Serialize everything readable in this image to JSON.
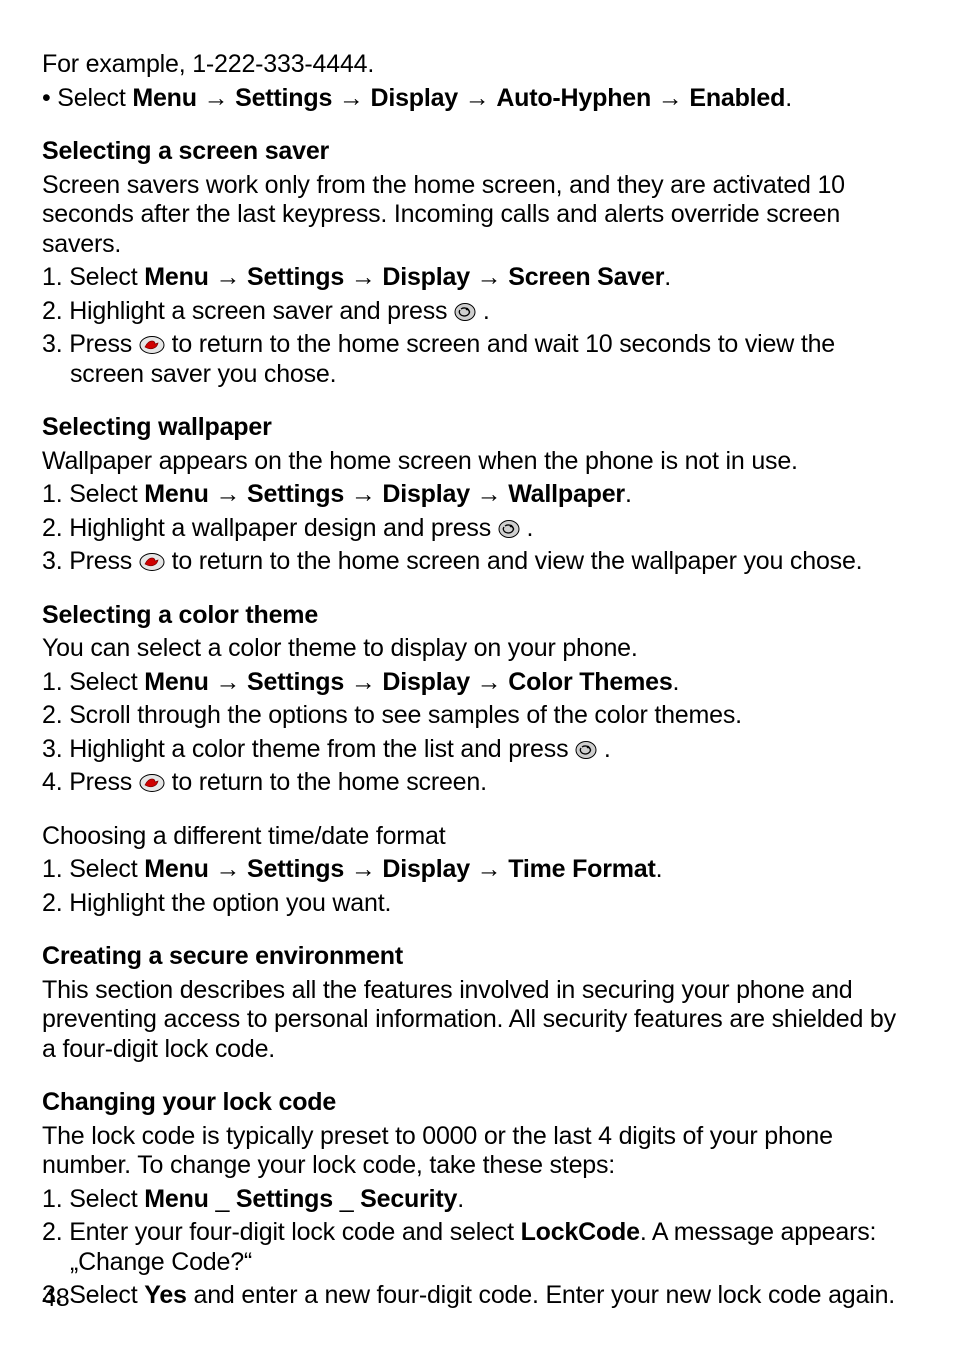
{
  "arrow": "→",
  "intro": {
    "line1": "For example, 1-222-333-4444.",
    "bullet_prefix": "• Select ",
    "path": [
      "Menu",
      "Settings",
      "Display",
      "Auto-Hyphen",
      "Enabled"
    ],
    "period": "."
  },
  "screensaver": {
    "heading": "Selecting a screen saver",
    "body": "Screen savers work only from the home screen, and they are activated 10 seconds after the last keypress. Incoming calls and alerts override screen savers.",
    "s1_prefix": "1. Select ",
    "s1_path": [
      "Menu",
      "Settings",
      "Display",
      "Screen Saver"
    ],
    "s2_a": "2. Highlight a screen saver and press ",
    "s2_b": " .",
    "s3_a": "3. Press ",
    "s3_b": " to return to the home screen and wait 10 seconds to view the screen saver you chose."
  },
  "wallpaper": {
    "heading": "Selecting wallpaper",
    "body": "Wallpaper appears on the home screen when the phone is not in use.",
    "s1_prefix": "1. Select ",
    "s1_path": [
      "Menu",
      "Settings",
      "Display",
      "Wallpaper"
    ],
    "s2_a": "2. Highlight a wallpaper design and press ",
    "s2_b": " .",
    "s3_a": "3. Press ",
    "s3_b": " to return to the home screen and view the wallpaper you chose."
  },
  "colortheme": {
    "heading": "Selecting a color theme",
    "body": "You can select a color theme to display on your phone.",
    "s1_prefix": "1. Select ",
    "s1_path": [
      "Menu",
      "Settings",
      "Display",
      "Color Themes"
    ],
    "s2": "2. Scroll through the options to see samples of the color themes.",
    "s3_a": "3. Highlight a color theme from the list and press ",
    "s3_b": " .",
    "s4_a": "4. Press ",
    "s4_b": " to return to the home screen."
  },
  "timedate": {
    "heading": "Choosing a different time/date format",
    "s1_prefix": "1. Select ",
    "s1_path": [
      "Menu",
      "Settings",
      "Display",
      "Time Format"
    ],
    "s2": "2. Highlight the option you want."
  },
  "secure": {
    "heading": "Creating a secure environment",
    "body": "This section describes all the features involved in securing your phone and preventing access to personal information. All security features are shielded by a four-digit lock code."
  },
  "lockcode": {
    "heading": "Changing your lock code",
    "body": "The lock code is typically preset to 0000 or the last 4 digits of your phone number. To change your lock code, take these steps:",
    "s1_prefix": "1. Select ",
    "s1_path": [
      "Menu",
      "Settings",
      "Security"
    ],
    "s1_sep": " _  ",
    "s2_a": "2. Enter your four-digit lock code and select ",
    "s2_bold": "LockCode",
    "s2_b": ". A message appears: „Change Code?“",
    "s3_a": "3. Select ",
    "s3_bold": "Yes",
    "s3_b": " and enter a new four-digit code. Enter your new lock code again."
  },
  "page_number": "48"
}
